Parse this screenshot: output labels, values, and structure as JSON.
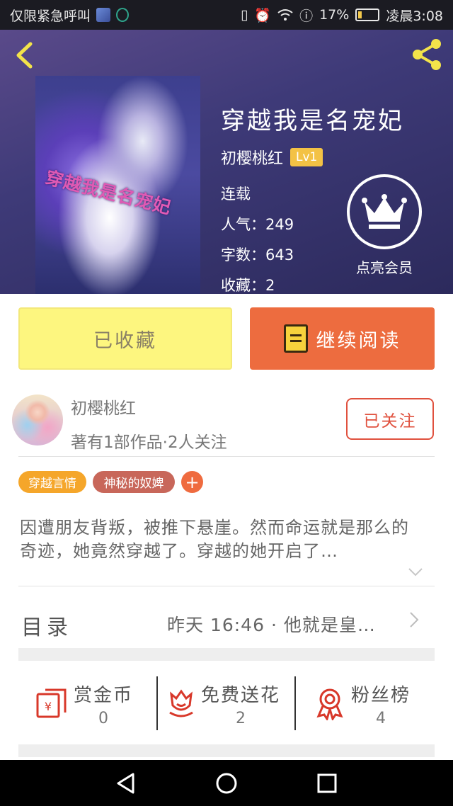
{
  "status_bar": {
    "carrier_text": "仅限紧急呼叫",
    "battery_percent": "17%",
    "time": "凌晨3:08"
  },
  "hero": {
    "cover_title": "穿越我是名宠妃",
    "title": "穿越我是名宠妃",
    "author": "初樱桃红",
    "level": "Lv1",
    "status": "连载",
    "popularity": "人气：249",
    "word_count": "字数：643",
    "favorites": "收藏：2",
    "vip_label": "点亮会员"
  },
  "actions": {
    "collected_label": "已收藏",
    "read_label": "继续阅读"
  },
  "author_info": {
    "name": "初樱桃红",
    "meta": "著有1部作品·2人关注",
    "follow_label": "已关注"
  },
  "tags": [
    {
      "label": "穿越言情",
      "color": "#f5a62a"
    },
    {
      "label": "神秘的奴婢",
      "color": "#c8675a"
    }
  ],
  "tag_add": "+",
  "description": "因遭朋友背叛，被推下悬崖。然而命运就是那么的奇迹，她竟然穿越了。穿越的她开启了…",
  "catalog": {
    "label": "目录",
    "latest": "昨天 16:46 · 他就是皇…"
  },
  "stats": {
    "reward": {
      "label": "赏金币",
      "value": "0"
    },
    "flowers": {
      "label": "免费送花",
      "value": "2"
    },
    "fans": {
      "label": "粉丝榜",
      "value": "4"
    }
  },
  "colors": {
    "accent_orange": "#ed6c3f",
    "collected_yellow": "#fdf67f",
    "follow_red": "#e0513e",
    "icon_red": "#d8382a"
  },
  "icons": [
    "back-icon",
    "share-icon",
    "crown-icon",
    "book-icon",
    "red-envelope-icon",
    "flower-icon",
    "award-icon",
    "chevron-down-icon",
    "chevron-right-icon",
    "nav-back-icon",
    "nav-home-icon",
    "nav-recents-icon"
  ]
}
